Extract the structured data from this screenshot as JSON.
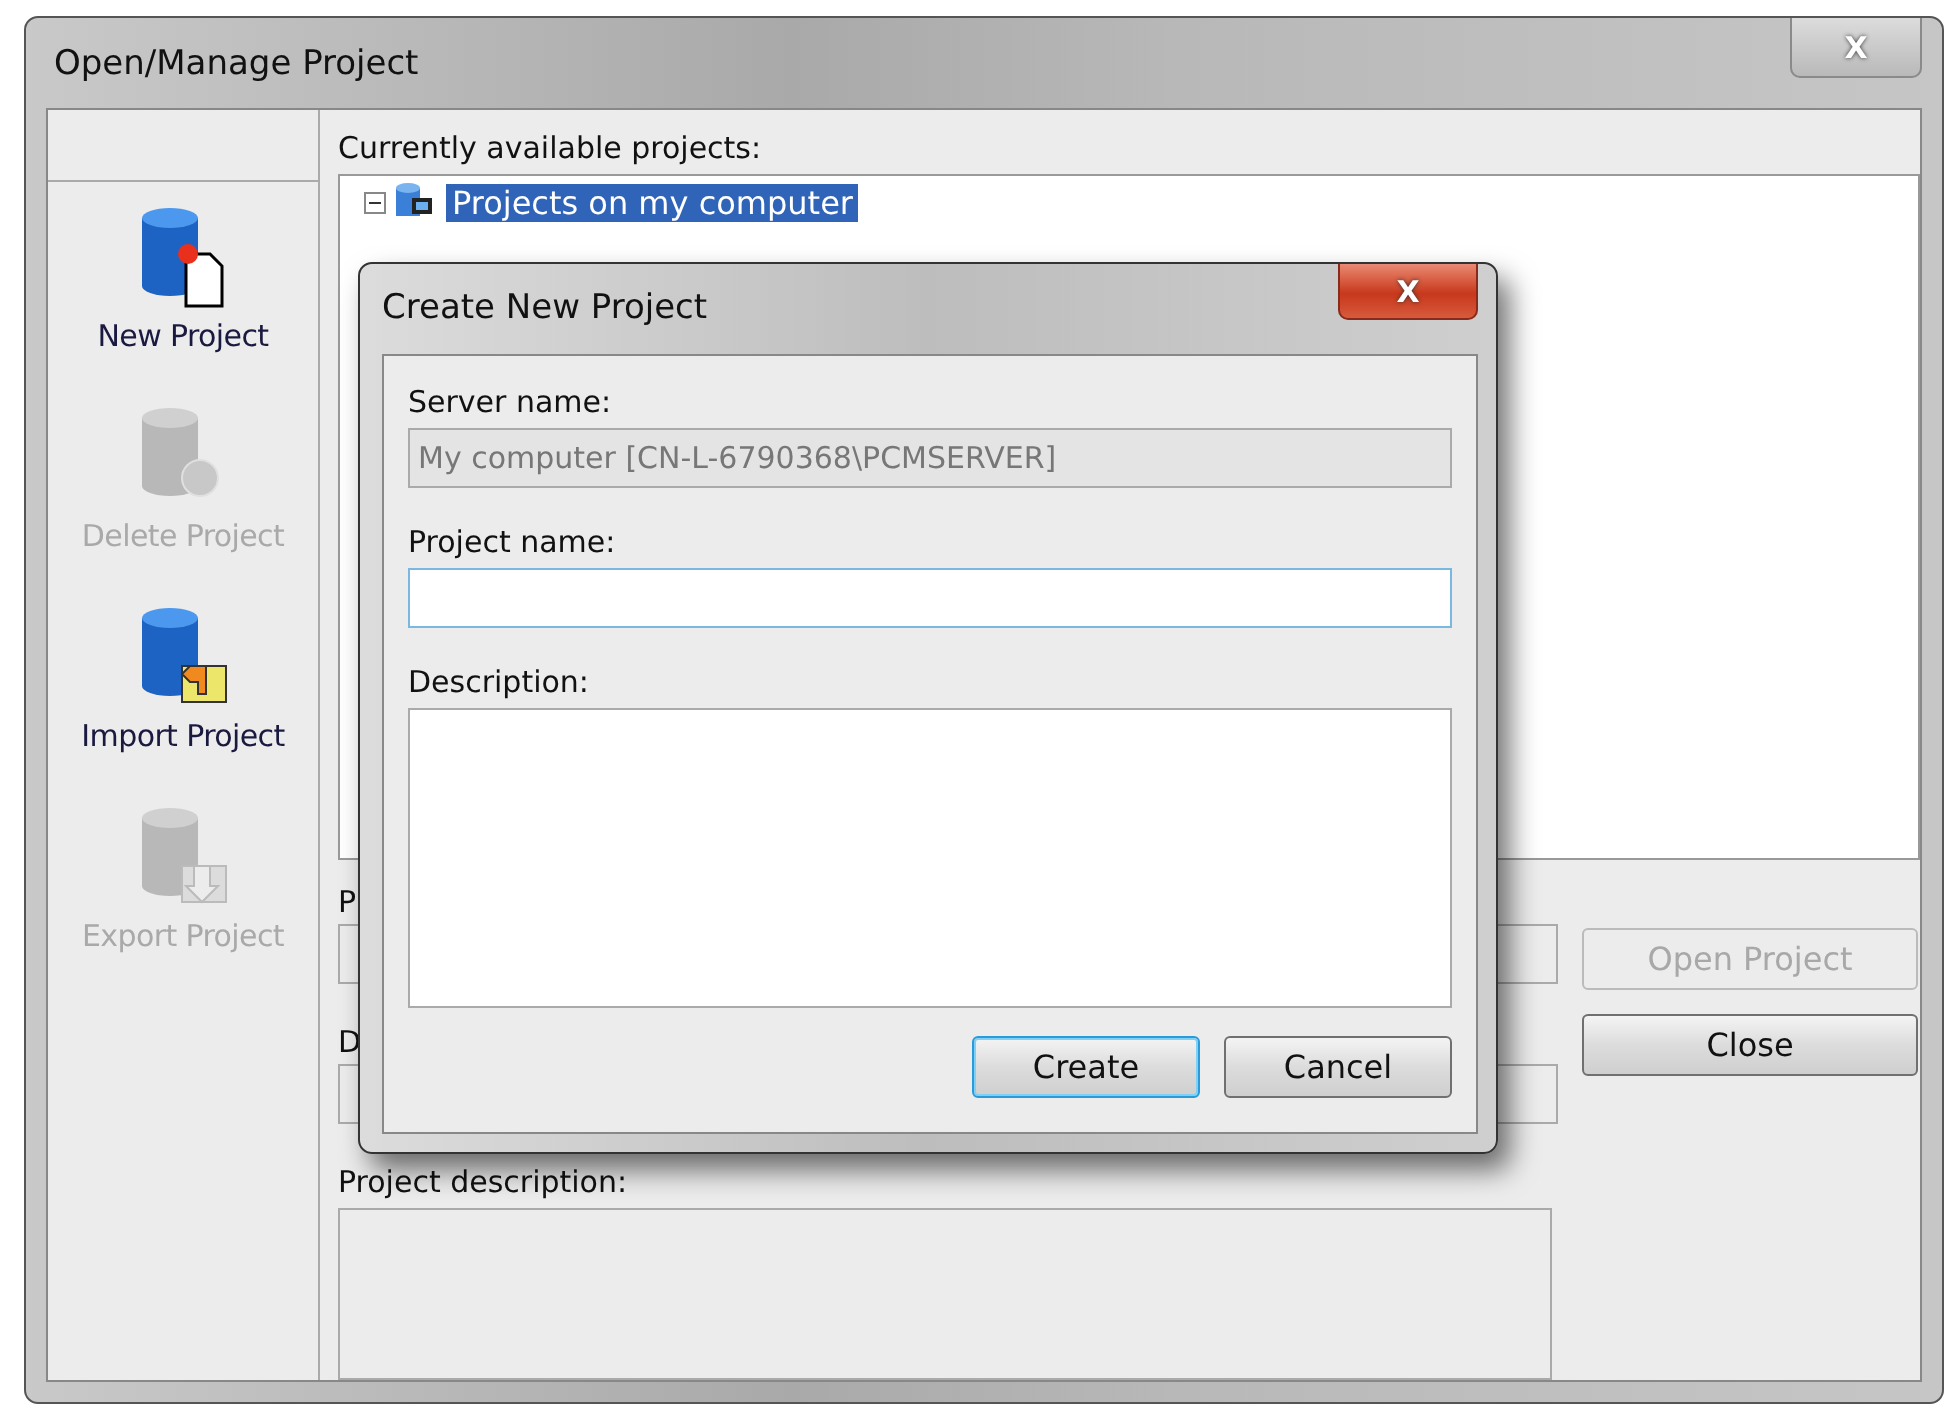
{
  "window": {
    "title": "Open/Manage Project",
    "close_label": "X"
  },
  "sidebar": {
    "items": [
      {
        "label": "New Project",
        "kind": "new",
        "disabled": false
      },
      {
        "label": "Delete Project",
        "kind": "delete",
        "disabled": true
      },
      {
        "label": "Import Project",
        "kind": "import",
        "disabled": false
      },
      {
        "label": "Export Project",
        "kind": "export",
        "disabled": true
      }
    ]
  },
  "projects": {
    "label": "Currently available projects:",
    "tree": [
      {
        "label": "Projects on my computer",
        "expanded": true,
        "selected": true
      }
    ]
  },
  "hidden_labels": [
    "P",
    "D"
  ],
  "buttons": [
    {
      "label": "Open Project",
      "disabled": true
    },
    {
      "label": "Close",
      "disabled": false
    }
  ],
  "project_description": {
    "label": "Project description:"
  },
  "dialog": {
    "title": "Create New Project",
    "close_label": "X",
    "server_name": {
      "label": "Server name:",
      "value": "My computer [CN-L-6790368\\PCMSERVER]"
    },
    "project_name": {
      "label": "Project name:"
    },
    "description": {
      "label": "Description:"
    },
    "buttons": [
      {
        "label": "Create",
        "focused": true
      },
      {
        "label": "Cancel",
        "focused": false
      }
    ]
  }
}
